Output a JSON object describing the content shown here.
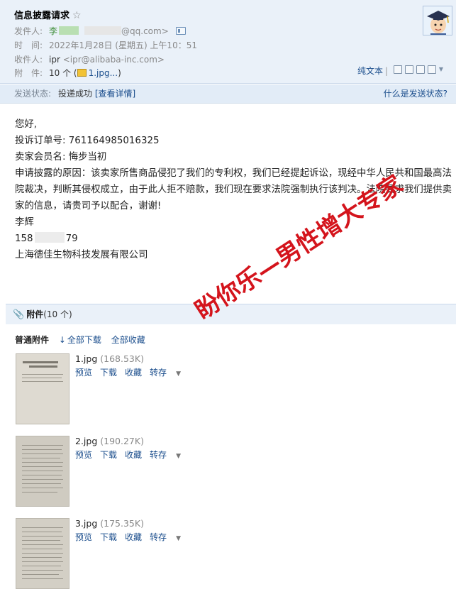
{
  "header": {
    "subject": "信息披露请求",
    "star": "☆",
    "from_label": "发件人:",
    "from_name": "李",
    "from_email": "@qq.com>",
    "time_label": "时　间:",
    "time_value": "2022年1月28日 (星期五) 上午10：51",
    "to_label": "收件人:",
    "to_name": "ipr",
    "to_email": "<ipr@alibaba-inc.com>",
    "attach_label": "附　件:",
    "attach_count": "10 个 (",
    "attach_file": "1.jpg...",
    "attach_close": ")",
    "plaintext": "纯文本",
    "plaintext_sep": "|"
  },
  "status": {
    "label": "发送状态:",
    "value": "投递成功",
    "detail_link": "[查看详情]",
    "help": "什么是发送状态?"
  },
  "body": {
    "greeting": "您好,",
    "order_line": "投诉订单号: 761164985016325",
    "member_line": "卖家会员名: 悔步当初",
    "reason": "申请披露的原因：该卖家所售商品侵犯了我们的专利权，我们已经提起诉讼，现经中华人民共和国最高法院裁决，判断其侵权成立，由于此人拒不赔款，我们现在要求法院强制执行该判决。法院要求我们提供卖家的信息，请贵司予以配合，谢谢!",
    "signer": "李辉",
    "phone_prefix": "158",
    "phone_suffix": "79",
    "company": "上海德佳生物科技发展有限公司"
  },
  "attachments": {
    "title": "附件",
    "count": "(10 个)",
    "normal_label": "普通附件",
    "download_all": "全部下载",
    "save_all": "全部收藏",
    "items": [
      {
        "name": "1.jpg",
        "size": "(168.53K)"
      },
      {
        "name": "2.jpg",
        "size": "(190.27K)"
      },
      {
        "name": "3.jpg",
        "size": "(175.35K)"
      }
    ],
    "actions": {
      "preview": "预览",
      "download": "下载",
      "save": "收藏",
      "forward": "转存",
      "caret": "▼"
    }
  },
  "watermark": "盼你乐—男性增大专家",
  "colors": {
    "accent": "#1a4d8c",
    "header_bg": "#eaf1f9",
    "watermark": "#d4141c"
  },
  "icons": [
    "star-icon",
    "card-icon",
    "image-icon",
    "avatar-graduate",
    "print-icon",
    "paperclip-icon",
    "download-arrow-icon",
    "caret-down-icon"
  ]
}
